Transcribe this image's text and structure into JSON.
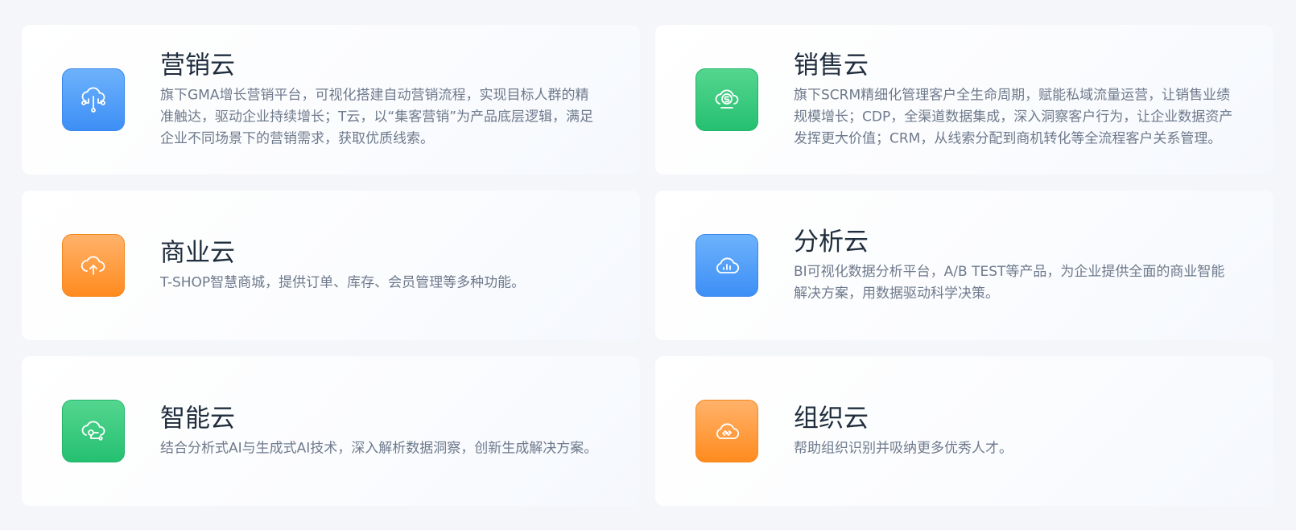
{
  "cards": [
    {
      "title": "营销云",
      "desc": "旗下GMA增长营销平台，可视化搭建自动营销流程，实现目标人群的精准触达，驱动企业持续增长；T云，以“集客营销”为产品底层逻辑，满足企业不同场景下的营销需求，获取优质线索。",
      "icon": "cloud-network-icon",
      "color": "#4a9af8"
    },
    {
      "title": "销售云",
      "desc": "旗下SCRM精细化管理客户全生命周期，赋能私域流量运营，让销售业绩规模增长；CDP，全渠道数据集成，深入洞察客户行为，让企业数据资产发挥更大价值；CRM，从线索分配到商机转化等全流程客户关系管理。",
      "icon": "cloud-coin-icon",
      "color": "#2ec777"
    },
    {
      "title": "商业云",
      "desc": "T-SHOP智慧商城，提供订单、库存、会员管理等多种功能。",
      "icon": "cloud-upload-icon",
      "color": "#ff9a3a"
    },
    {
      "title": "分析云",
      "desc": "BI可视化数据分析平台，A/B TEST等产品，为企业提供全面的商业智能解决方案，用数据驱动科学决策。",
      "icon": "cloud-chart-icon",
      "color": "#4a9af8"
    },
    {
      "title": "智能云",
      "desc": "结合分析式AI与生成式AI技术，深入解析数据洞察，创新生成解决方案。",
      "icon": "cloud-ai-icon",
      "color": "#2ec777"
    },
    {
      "title": "组织云",
      "desc": "帮助组织识别并吸纳更多优秀人才。",
      "icon": "cloud-link-icon",
      "color": "#ff9a3a"
    }
  ]
}
